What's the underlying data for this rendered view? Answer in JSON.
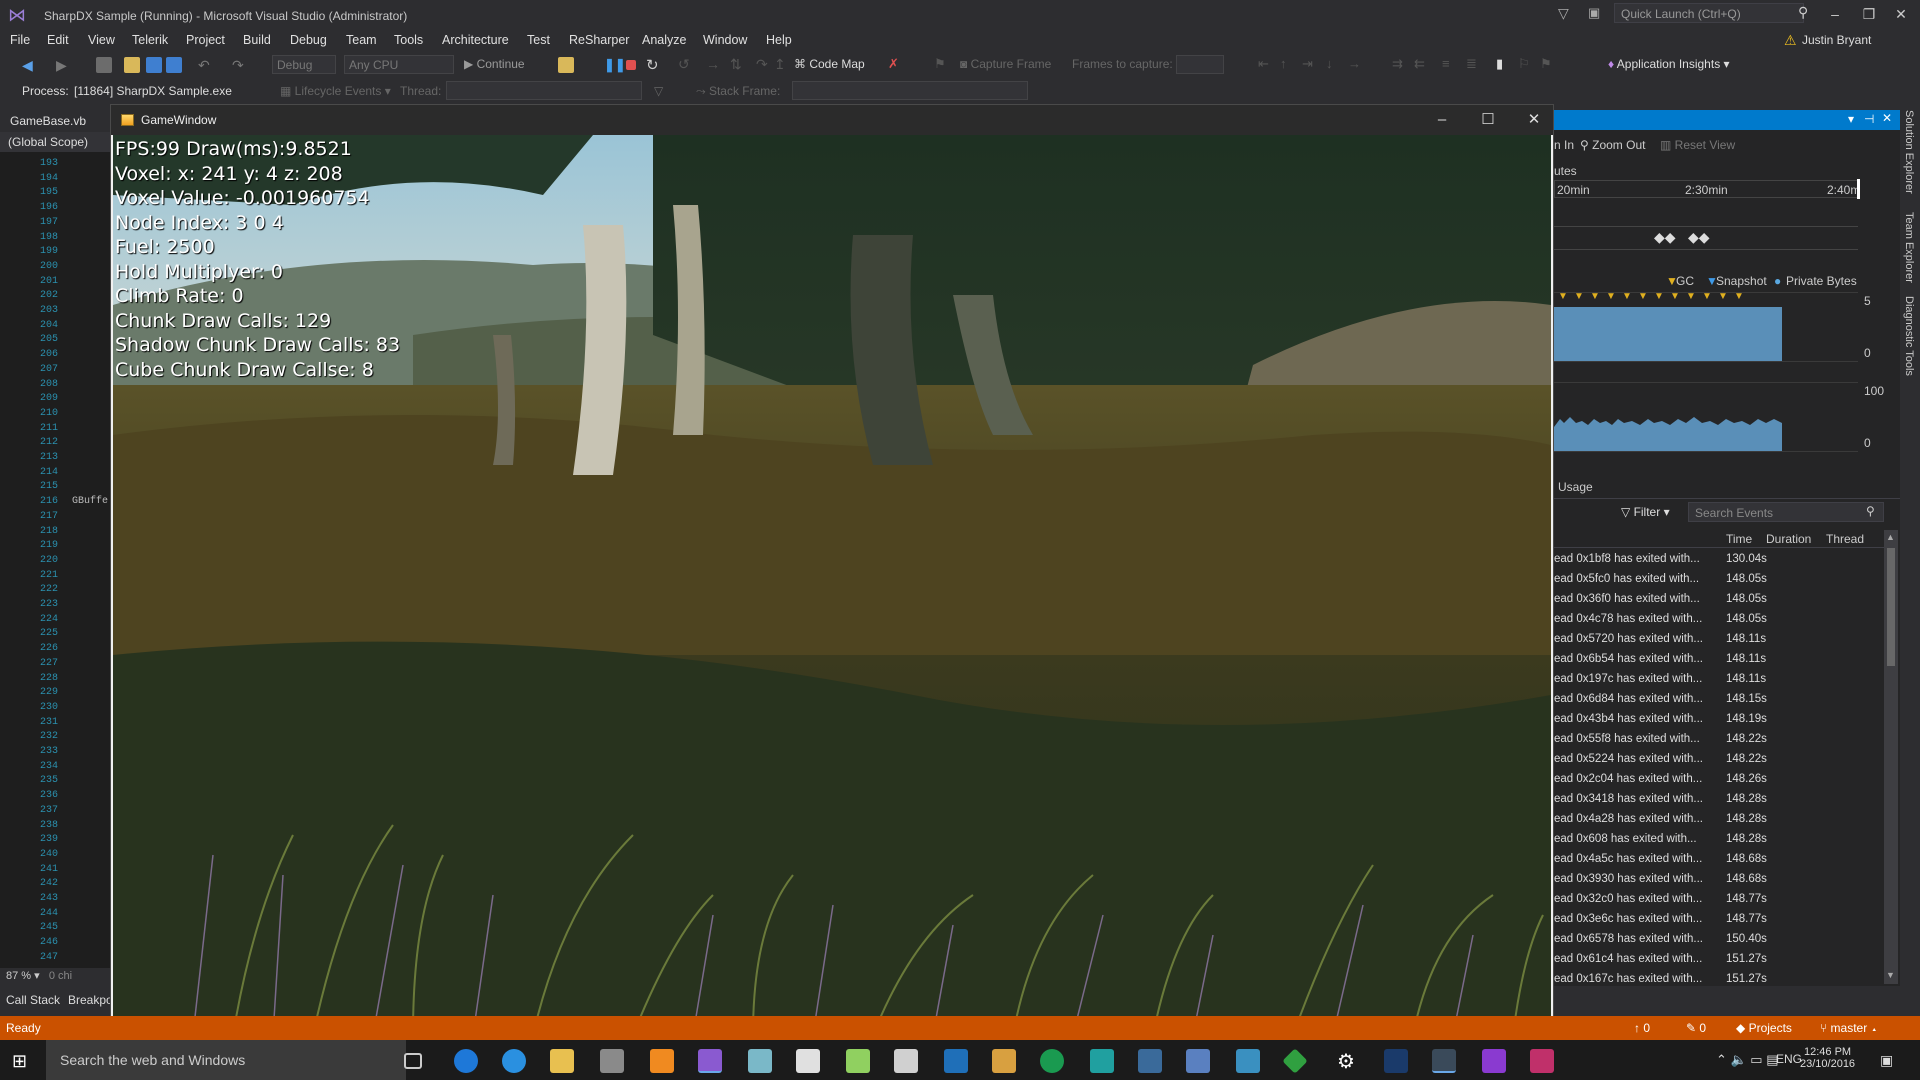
{
  "window": {
    "title": "SharpDX Sample (Running) - Microsoft Visual Studio (Administrator)",
    "quick_launch_placeholder": "Quick Launch (Ctrl+Q)",
    "user": "Justin Bryant"
  },
  "menu": [
    "File",
    "Edit",
    "View",
    "Telerik",
    "Project",
    "Build",
    "Debug",
    "Team",
    "Tools",
    "Architecture",
    "Test",
    "ReSharper",
    "Analyze",
    "Window",
    "Help"
  ],
  "toolbar": {
    "config": "Debug",
    "platform": "Any CPU",
    "continue": "Continue",
    "code_map": "Code Map",
    "capture_frame": "Capture Frame",
    "frames_to_capture": "Frames to capture:",
    "app_insights": "Application Insights"
  },
  "toolbar2": {
    "process_label": "Process:",
    "process_value": "[11864] SharpDX Sample.exe",
    "lifecycle": "Lifecycle Events",
    "thread": "Thread:",
    "stack_frame": "Stack Frame:"
  },
  "editor": {
    "tab": "GameBase.vb",
    "scope": "(Global Scope)",
    "zoom": "87 %",
    "lines": [
      "193",
      "194",
      "195",
      "196",
      "197",
      "198",
      "199",
      "200",
      "201",
      "202",
      "203",
      "204",
      "205",
      "206",
      "207",
      "208",
      "209",
      "210",
      "211",
      "212",
      "213",
      "214",
      "215",
      "216",
      "217",
      "218",
      "219",
      "220",
      "221",
      "222",
      "223",
      "224",
      "225",
      "226",
      "227",
      "228",
      "229",
      "230",
      "231",
      "232",
      "233",
      "234",
      "235",
      "236",
      "237",
      "238",
      "239",
      "240",
      "241",
      "242",
      "243",
      "244",
      "245",
      "246",
      "247"
    ],
    "frag216": "GBuffe",
    "frag_chars": "0 chi"
  },
  "bottom_tabs": [
    "Call Stack",
    "Breakpo"
  ],
  "status": {
    "ready": "Ready",
    "up": "0",
    "pencil": "0",
    "projects": "Projects",
    "branch": "master"
  },
  "game": {
    "title": "GameWindow",
    "hud": [
      "FPS:99 Draw(ms):9.8521",
      "Voxel: x: 241 y: 4 z: 208",
      "Voxel Value: -0.001960754",
      "Node Index: 3 0 4",
      "Fuel: 2500",
      "Hold Multiplyer: 0",
      "Climb Rate: 0",
      "Chunk Draw Calls: 129",
      "Shadow Chunk Draw Calls: 83",
      "Cube Chunk Draw Callse: 8"
    ]
  },
  "diagnostics": {
    "zoom_in": "n In",
    "zoom_out": "Zoom Out",
    "reset_view": "Reset View",
    "section": "utes",
    "t1": "20min",
    "t2": "2:30min",
    "t3": "2:40m",
    "legend": {
      "gc": "GC",
      "snapshot": "Snapshot",
      "private_bytes": "Private Bytes"
    },
    "mem_max": "5",
    "mem_min": "0",
    "cpu_max": "100",
    "cpu_min": "0",
    "usage": "Usage",
    "filter": "Filter",
    "search_events": "Search Events",
    "columns": {
      "time": "Time",
      "duration": "Duration",
      "thread": "Thread"
    },
    "events": [
      {
        "text": "ead 0x1bf8 has exited with...",
        "time": "130.04s"
      },
      {
        "text": "ead 0x5fc0 has exited with...",
        "time": "148.05s"
      },
      {
        "text": "ead 0x36f0 has exited with...",
        "time": "148.05s"
      },
      {
        "text": "ead 0x4c78 has exited with...",
        "time": "148.05s"
      },
      {
        "text": "ead 0x5720 has exited with...",
        "time": "148.11s"
      },
      {
        "text": "ead 0x6b54 has exited with...",
        "time": "148.11s"
      },
      {
        "text": "ead 0x197c has exited with...",
        "time": "148.11s"
      },
      {
        "text": "ead 0x6d84 has exited with...",
        "time": "148.15s"
      },
      {
        "text": "ead 0x43b4 has exited with...",
        "time": "148.19s"
      },
      {
        "text": "ead 0x55f8 has exited with...",
        "time": "148.22s"
      },
      {
        "text": "ead 0x5224 has exited with...",
        "time": "148.22s"
      },
      {
        "text": "ead 0x2c04 has exited with...",
        "time": "148.26s"
      },
      {
        "text": "ead 0x3418 has exited with...",
        "time": "148.28s"
      },
      {
        "text": "ead 0x4a28 has exited with...",
        "time": "148.28s"
      },
      {
        "text": "ead 0x608 has exited with...",
        "time": "148.28s"
      },
      {
        "text": "ead 0x4a5c has exited with...",
        "time": "148.68s"
      },
      {
        "text": "ead 0x3930 has exited with...",
        "time": "148.68s"
      },
      {
        "text": "ead 0x32c0 has exited with...",
        "time": "148.77s"
      },
      {
        "text": "ead 0x3e6c has exited with...",
        "time": "148.77s"
      },
      {
        "text": "ead 0x6578 has exited with...",
        "time": "150.40s"
      },
      {
        "text": "ead 0x61c4 has exited with...",
        "time": "151.27s"
      },
      {
        "text": "ead 0x167c has exited with...",
        "time": "151.27s"
      }
    ]
  },
  "side_tabs": [
    "Solution Explorer",
    "Team Explorer",
    "Diagnostic Tools"
  ],
  "taskbar": {
    "search": "Search the web and Windows",
    "time": "12:46 PM",
    "date": "23/10/2016",
    "lang": "ENG"
  }
}
